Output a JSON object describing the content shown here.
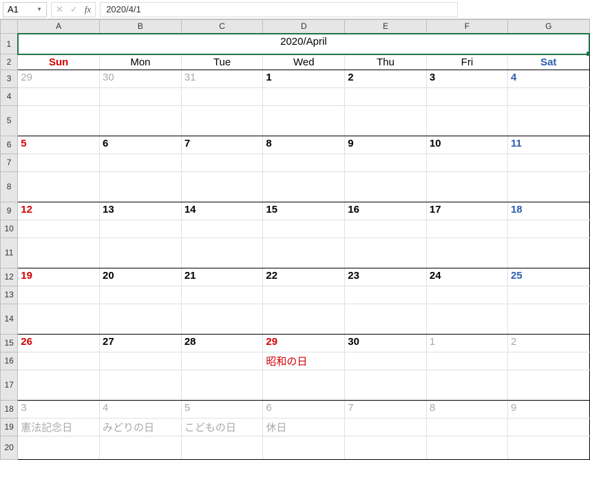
{
  "formula_bar": {
    "cell_ref": "A1",
    "cancel": "✕",
    "confirm": "✓",
    "fx": "fx",
    "value": "2020/4/1"
  },
  "columns": [
    "A",
    "B",
    "C",
    "D",
    "E",
    "F",
    "G"
  ],
  "rows": [
    "1",
    "2",
    "3",
    "4",
    "5",
    "6",
    "7",
    "8",
    "9",
    "10",
    "11",
    "12",
    "13",
    "14",
    "15",
    "16",
    "17",
    "18",
    "19",
    "20"
  ],
  "title": "2020/April",
  "day_headers": [
    "Sun",
    "Mon",
    "Tue",
    "Wed",
    "Thu",
    "Fri",
    "Sat"
  ],
  "weeks": [
    {
      "days": [
        {
          "n": "29",
          "cls": "dim"
        },
        {
          "n": "30",
          "cls": "dim"
        },
        {
          "n": "31",
          "cls": "dim"
        },
        {
          "n": "1",
          "cls": ""
        },
        {
          "n": "2",
          "cls": ""
        },
        {
          "n": "3",
          "cls": ""
        },
        {
          "n": "4",
          "cls": "blue"
        }
      ],
      "events": [
        "",
        "",
        "",
        "",
        "",
        "",
        ""
      ]
    },
    {
      "days": [
        {
          "n": "5",
          "cls": "red"
        },
        {
          "n": "6",
          "cls": ""
        },
        {
          "n": "7",
          "cls": ""
        },
        {
          "n": "8",
          "cls": ""
        },
        {
          "n": "9",
          "cls": ""
        },
        {
          "n": "10",
          "cls": ""
        },
        {
          "n": "11",
          "cls": "blue"
        }
      ],
      "events": [
        "",
        "",
        "",
        "",
        "",
        "",
        ""
      ]
    },
    {
      "days": [
        {
          "n": "12",
          "cls": "red"
        },
        {
          "n": "13",
          "cls": ""
        },
        {
          "n": "14",
          "cls": ""
        },
        {
          "n": "15",
          "cls": ""
        },
        {
          "n": "16",
          "cls": ""
        },
        {
          "n": "17",
          "cls": ""
        },
        {
          "n": "18",
          "cls": "blue"
        }
      ],
      "events": [
        "",
        "",
        "",
        "",
        "",
        "",
        ""
      ]
    },
    {
      "days": [
        {
          "n": "19",
          "cls": "red"
        },
        {
          "n": "20",
          "cls": ""
        },
        {
          "n": "21",
          "cls": ""
        },
        {
          "n": "22",
          "cls": ""
        },
        {
          "n": "23",
          "cls": ""
        },
        {
          "n": "24",
          "cls": ""
        },
        {
          "n": "25",
          "cls": "blue"
        }
      ],
      "events": [
        "",
        "",
        "",
        "",
        "",
        "",
        ""
      ]
    },
    {
      "days": [
        {
          "n": "26",
          "cls": "red"
        },
        {
          "n": "27",
          "cls": ""
        },
        {
          "n": "28",
          "cls": ""
        },
        {
          "n": "29",
          "cls": "red"
        },
        {
          "n": "30",
          "cls": ""
        },
        {
          "n": "1",
          "cls": "dim"
        },
        {
          "n": "2",
          "cls": "dim"
        }
      ],
      "events": [
        "",
        "",
        "",
        "昭和の日",
        "",
        "",
        ""
      ],
      "ev_cls": [
        "",
        "",
        "",
        "evred",
        "",
        "",
        ""
      ]
    },
    {
      "days": [
        {
          "n": "3",
          "cls": "dim"
        },
        {
          "n": "4",
          "cls": "dim"
        },
        {
          "n": "5",
          "cls": "dim"
        },
        {
          "n": "6",
          "cls": "dim"
        },
        {
          "n": "7",
          "cls": "dim"
        },
        {
          "n": "8",
          "cls": "dim"
        },
        {
          "n": "9",
          "cls": "dim"
        }
      ],
      "events": [
        "憲法記念日",
        "みどりの日",
        "こどもの日",
        "休日",
        "",
        "",
        ""
      ],
      "ev_cls": [
        "evdim",
        "evdim",
        "evdim",
        "evdim",
        "",
        "",
        ""
      ]
    }
  ]
}
